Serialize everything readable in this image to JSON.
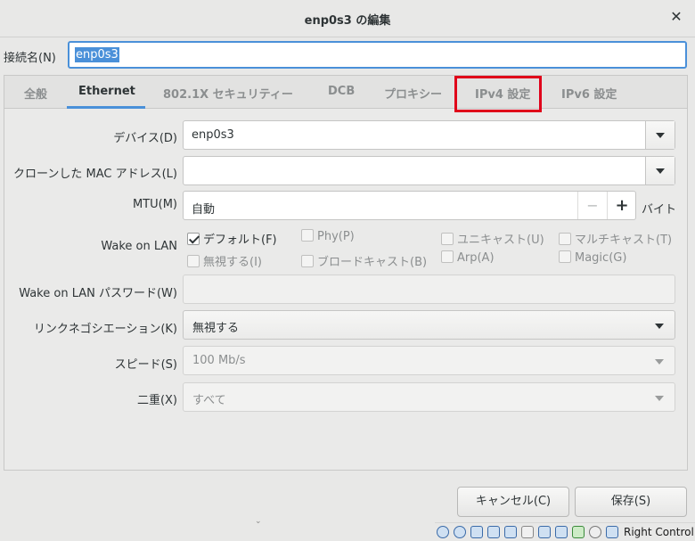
{
  "window": {
    "title": "enp0s3 の編集"
  },
  "connection": {
    "label": "接続名(N)",
    "value": "enp0s3"
  },
  "tabs": [
    {
      "label": "全般"
    },
    {
      "label": "Ethernet"
    },
    {
      "label": "802.1X セキュリティー"
    },
    {
      "label": "DCB"
    },
    {
      "label": "プロキシー"
    },
    {
      "label": "IPv4 設定"
    },
    {
      "label": "IPv6 設定"
    }
  ],
  "active_tab": "Ethernet",
  "highlighted_tab": "IPv4 設定",
  "form": {
    "device": {
      "label": "デバイス(D)",
      "value": "enp0s3"
    },
    "cloned_mac": {
      "label": "クローンした MAC アドレス(L)",
      "value": ""
    },
    "mtu": {
      "label": "MTU(M)",
      "value": "自動",
      "unit": "バイト",
      "minus": "−",
      "plus": "+"
    },
    "wake_on_lan": {
      "label": "Wake on LAN",
      "options": [
        {
          "label": "デフォルト(F)",
          "checked": true
        },
        {
          "label": "Phy(P)",
          "checked": false
        },
        {
          "label": "ユニキャスト(U)",
          "checked": false
        },
        {
          "label": "マルチキャスト(T)",
          "checked": false
        },
        {
          "label": "無視する(I)",
          "checked": false
        },
        {
          "label": "ブロードキャスト(B)",
          "checked": false
        },
        {
          "label": "Arp(A)",
          "checked": false
        },
        {
          "label": "Magic(G)",
          "checked": false
        }
      ]
    },
    "wol_password": {
      "label": "Wake on LAN パスワード(W)",
      "value": ""
    },
    "negotiation": {
      "label": "リンクネゴシエーション(K)",
      "value": "無視する"
    },
    "speed": {
      "label": "スピード(S)",
      "value": "100 Mb/s"
    },
    "duplex": {
      "label": "二重(X)",
      "value": "すべて"
    }
  },
  "buttons": {
    "cancel": "キャンセル(C)",
    "save": "保存(S)"
  },
  "taskbar": {
    "host_key": "Right Control"
  },
  "colors": {
    "accent": "#4a90d9",
    "highlight": "#e0001a"
  }
}
